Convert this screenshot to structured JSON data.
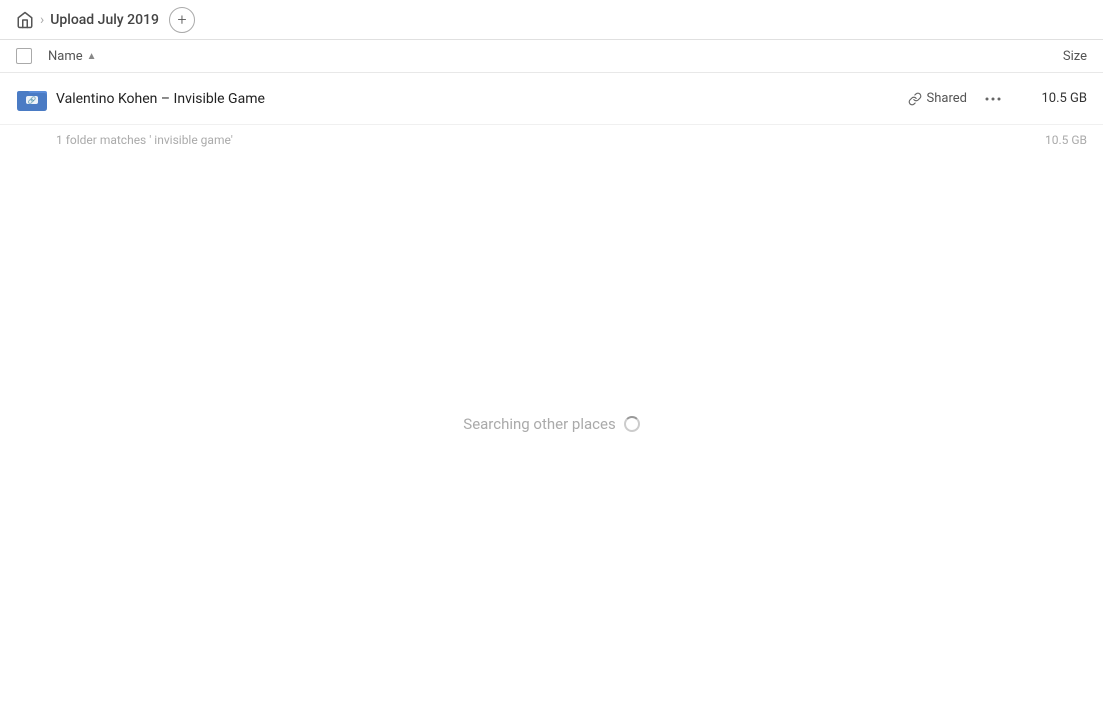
{
  "header": {
    "home_icon": "home",
    "breadcrumb_title": "Upload July 2019",
    "add_button_label": "+"
  },
  "columns": {
    "name_label": "Name",
    "size_label": "Size"
  },
  "file_row": {
    "icon_type": "folder-link",
    "name": "Valentino Kohen – Invisible Game",
    "shared_label": "Shared",
    "more_icon": "···",
    "size": "10.5 GB"
  },
  "summary": {
    "text": "1 folder matches ' invisible game'",
    "size": "10.5 GB"
  },
  "searching": {
    "label": "Searching other places"
  }
}
